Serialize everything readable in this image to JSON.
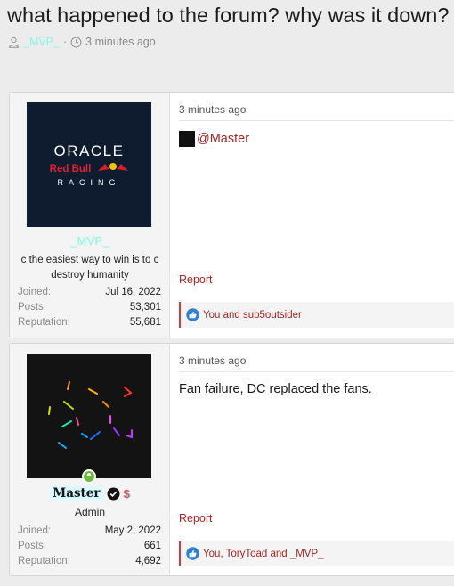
{
  "thread": {
    "title": "what happened to the forum? why was it down?",
    "author": "_MVP_",
    "separator": "·",
    "time": "3 minutes ago"
  },
  "posts": [
    {
      "avatar_text": {
        "line1": "ORACLE",
        "line2": "Red Bull",
        "line3": "RACING"
      },
      "username": "_MVP_",
      "user_title": "c the easiest way to win is to c destroy humanity",
      "stats": [
        {
          "label": "Joined:",
          "value": "Jul 16, 2022"
        },
        {
          "label": "Posts:",
          "value": "53,301"
        },
        {
          "label": "Reputation:",
          "value": "55,681"
        }
      ],
      "time": "3 minutes ago",
      "message_mention": "@Master",
      "report_label": "Report",
      "reactions_text": "You and sub5outsider"
    },
    {
      "username": "Master",
      "role": "Admin",
      "badge_symbol": "$",
      "stats": [
        {
          "label": "Joined:",
          "value": "May 2, 2022"
        },
        {
          "label": "Posts:",
          "value": "661"
        },
        {
          "label": "Reputation:",
          "value": "4,692"
        }
      ],
      "time": "3 minutes ago",
      "message": "Fan failure, DC replaced the fans.",
      "report_label": "Report",
      "reactions_text": "You, ToryToad and _MVP_"
    }
  ],
  "icons": {
    "user": "user-icon",
    "clock": "clock-icon",
    "like": "like-icon",
    "verified": "verified-check-icon",
    "online": "online-status-icon"
  },
  "colors": {
    "accent_red": "#a52424",
    "mvp_name": "#9aefe0",
    "like_blue": "#2f7fd2",
    "online_green": "#6dbb3a"
  }
}
